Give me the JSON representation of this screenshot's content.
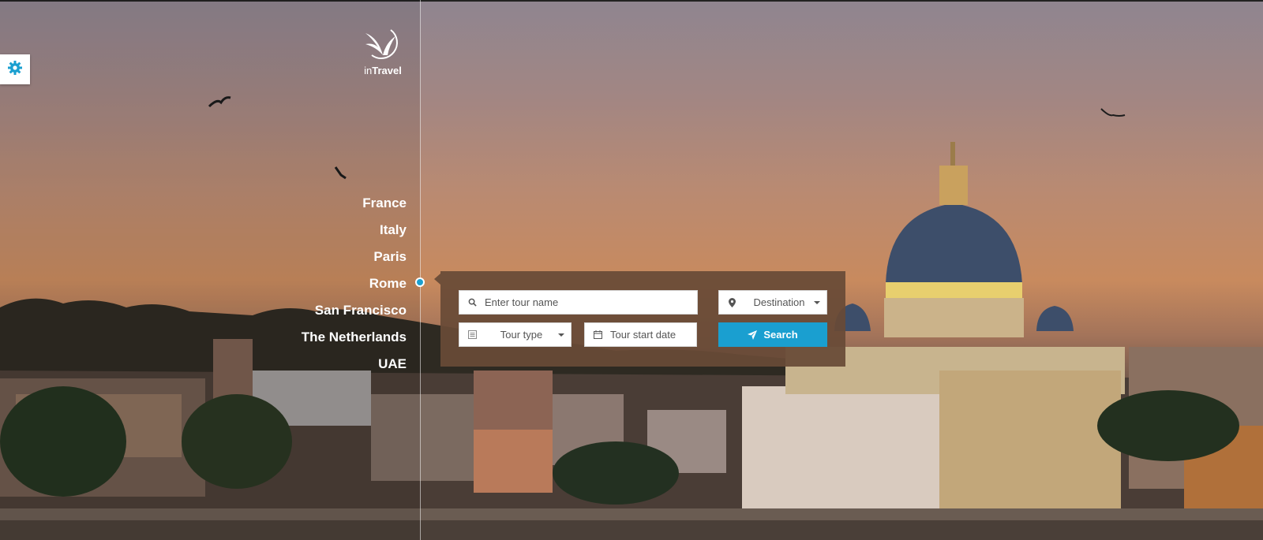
{
  "brand": {
    "logo_prefix": "in",
    "logo_bold": "Travel"
  },
  "settings": {
    "icon": "gear-icon"
  },
  "destinations": [
    {
      "label": "France"
    },
    {
      "label": "Italy"
    },
    {
      "label": "Paris"
    },
    {
      "label": "Rome"
    },
    {
      "label": "San Francisco"
    },
    {
      "label": "The Netherlands"
    },
    {
      "label": "UAE"
    }
  ],
  "active_destination": "Rome",
  "search": {
    "tour_name_placeholder": "Enter tour name",
    "destination_label": "Destination",
    "tour_type_label": "Tour type",
    "start_date_placeholder": "Tour start date",
    "search_button_label": "Search"
  },
  "colors": {
    "accent": "#1a9fd0",
    "panel": "#684a37"
  }
}
